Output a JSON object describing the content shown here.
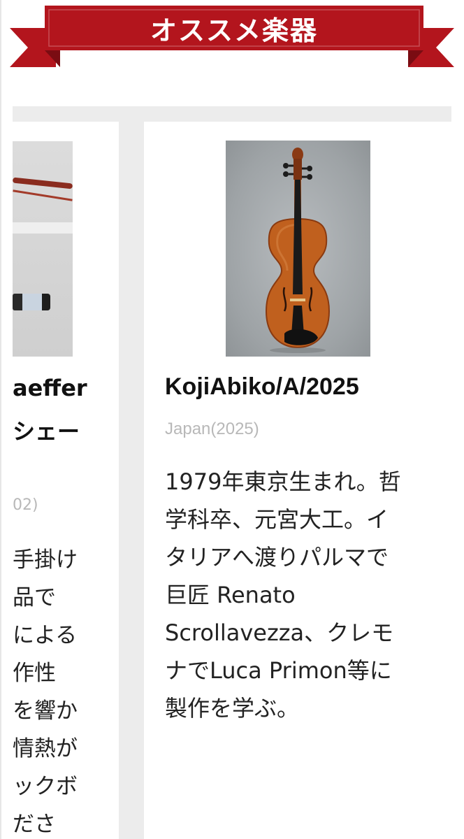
{
  "banner": {
    "title": "オススメ楽器",
    "color": "#b3151d"
  },
  "left_card": {
    "name_fragment": "aeffer",
    "name_sub_fragment": "シェー",
    "origin_fragment": "02)",
    "description_lines": [
      "手掛け",
      "品で",
      "による",
      "作性",
      "を響か",
      "情熱が",
      "ックボ",
      "ださ"
    ]
  },
  "right_card": {
    "name": "KojiAbiko/A/2025",
    "origin": "Japan(2025)",
    "description_lines": [
      "1979年東京生まれ。哲",
      "学科卒、元宮大工。イ",
      "タリアへ渡りパルマで",
      "巨匠 Renato",
      "Scrollavezza、クレモ",
      "ナでLuca Primon等に",
      "製作を学ぶ。"
    ]
  }
}
